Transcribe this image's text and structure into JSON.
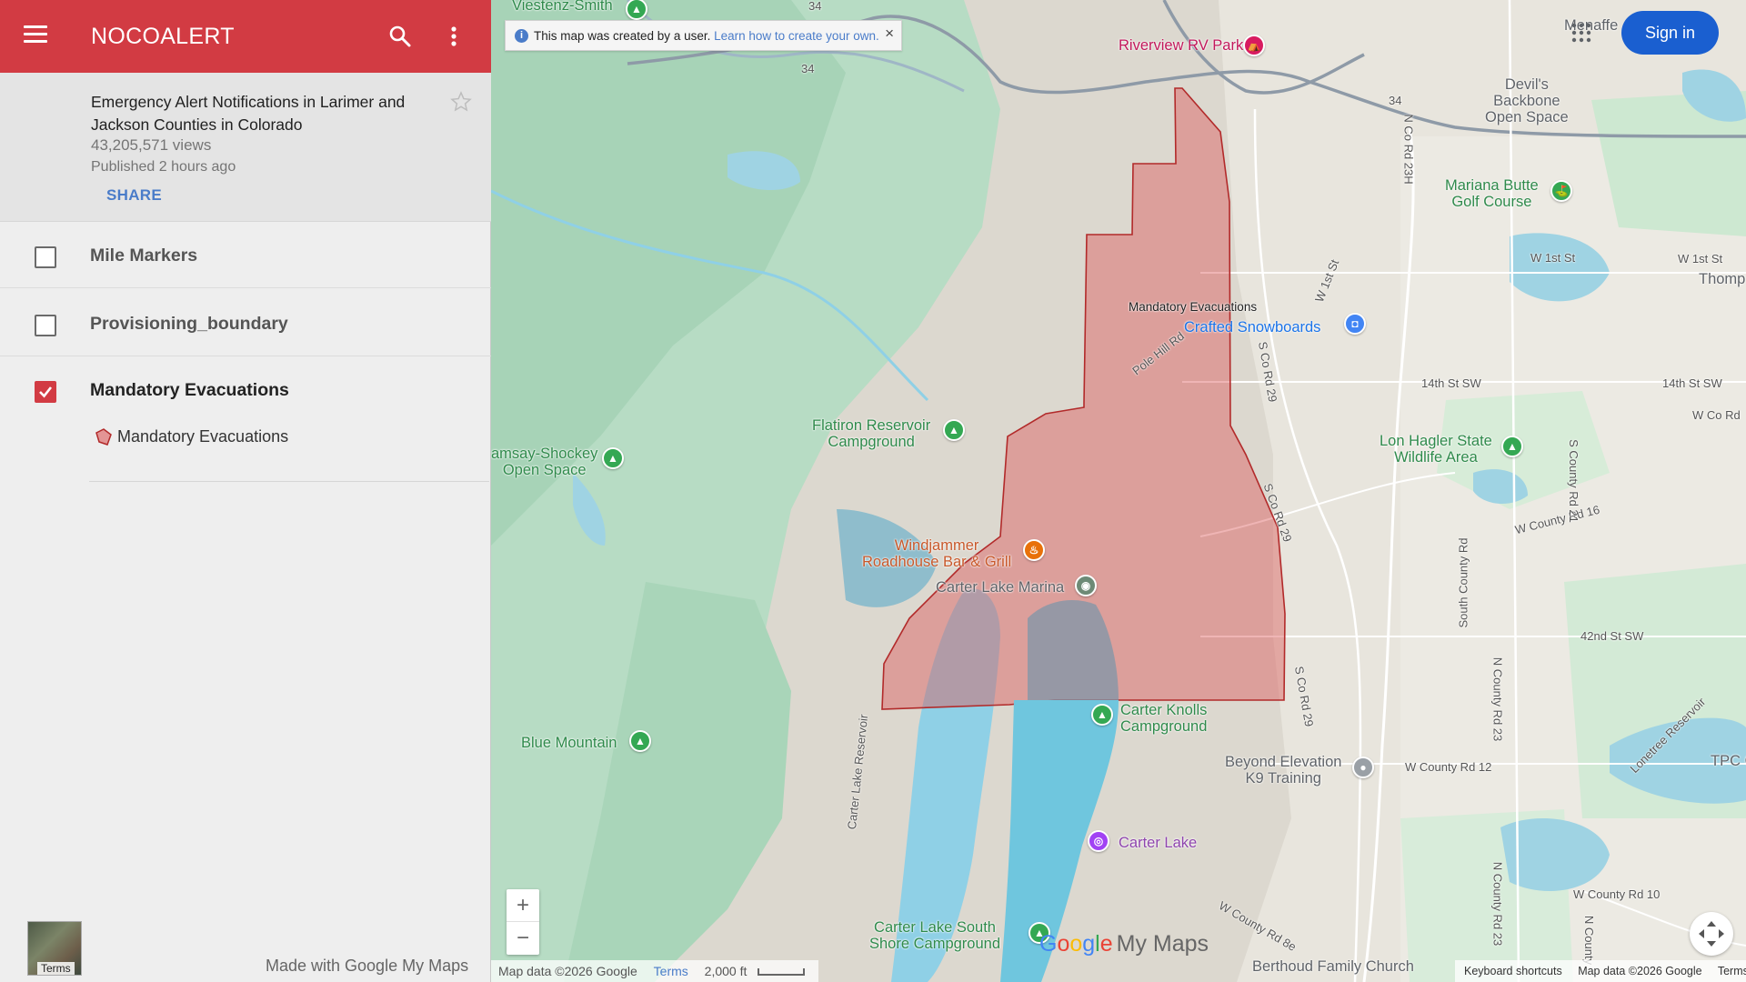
{
  "app": {
    "title": "NOCOALERT"
  },
  "map_info": {
    "description": "Emergency Alert Notifications in Larimer and Jackson Counties in Colorado",
    "views": "43,205,571 views",
    "published": "Published 2 hours ago",
    "share_label": "SHARE"
  },
  "layers": [
    {
      "name": "Mile Markers",
      "checked": false
    },
    {
      "name": "Provisioning_boundary",
      "checked": false
    },
    {
      "name": "Mandatory Evacuations",
      "checked": true,
      "items": [
        "Mandatory Evacuations"
      ]
    }
  ],
  "sidebar_footer": {
    "made_with": "Made with Google My Maps",
    "thumb_terms": "Terms"
  },
  "notice": {
    "text": "This map was created by a user.",
    "link": "Learn how to create your own.",
    "close": "×"
  },
  "header": {
    "sign_in": "Sign in"
  },
  "zoom": {
    "in": "+",
    "out": "−"
  },
  "logo": {
    "google": [
      "G",
      "o",
      "o",
      "g",
      "l",
      "e"
    ],
    "suffix": "My Maps"
  },
  "attribution": {
    "map_data": "Map data ©2026 Google",
    "terms": "Terms",
    "scale": "2,000 ft",
    "keyboard_shortcuts": "Keyboard shortcuts",
    "map_data_right": "Map data ©2026 Google",
    "terms_right": "Terms"
  },
  "map_labels": {
    "viestenz_smith": "Viestenz-Smith",
    "riverview": "Riverview RV Park",
    "devils_backbone_1": "Devil's",
    "devils_backbone_2": "Backbone",
    "devils_backbone_3": "Open Space",
    "mariana_butte_1": "Mariana Butte",
    "mariana_butte_2": "Golf Course",
    "mandatory_evac": "Mandatory Evacuations",
    "crafted": "Crafted Snowboards",
    "flatiron_1": "Flatiron Reservoir",
    "flatiron_2": "Campground",
    "ramsay_1": "amsay-Shockey",
    "ramsay_2": "Open Space",
    "lon_hagler_1": "Lon Hagler State",
    "lon_hagler_2": "Wildlife Area",
    "windjammer_1": "Windjammer",
    "windjammer_2": "Roadhouse Bar & Grill",
    "carter_marina": "Carter Lake Marina",
    "carter_knolls_1": "Carter Knolls",
    "carter_knolls_2": "Campground",
    "blue_mountain": "Blue Mountain",
    "beyond_elevation_1": "Beyond Elevation",
    "beyond_elevation_2": "K9 Training",
    "carter_lake": "Carter Lake",
    "carter_south_1": "Carter Lake South",
    "carter_south_2": "Shore Campground",
    "berthoud": "Berthoud Family Church",
    "tpc": "TPC C",
    "thomp": "Thomp",
    "menaffe": "Menaffe",
    "w1st_a": "W 1st St",
    "w1st_b": "W 1st St",
    "w14th_a": "14th St SW",
    "w14th_b": "14th St SW",
    "wcord": "W Co Rd",
    "w42nd": "42nd St SW",
    "wcr16": "W County Rd 16",
    "wcr12": "W County Rd 12",
    "wcr10": "W County Rd 10",
    "lonetree": "Lonetree Reservoir",
    "ncord23h": "N Co Rd 23H",
    "w1st_diag": "W 1st St",
    "pole_hill": "Pole Hill Rd",
    "sco29_a": "S Co Rd 29",
    "sco29_b": "S Co Rd 29",
    "sco29_c": "S Co Rd 29",
    "scr21": "S County Rd 21",
    "south_cr": "South County Rd",
    "ncr23_a": "N County Rd 23",
    "ncr23_b": "N County Rd 23",
    "ncounty_rd": "N County",
    "wcr8e": "W County Rd 8e",
    "carter_res_rd": "Carter Lake Reservoir",
    "hwy34_a": "34",
    "hwy34_b": "34",
    "hwy34_c": "34"
  },
  "colors": {
    "brand_red": "#d23b43",
    "link_blue": "#4a7cc9",
    "evac_fill": "rgba(220,90,90,0.45)",
    "evac_stroke": "#b22a2a"
  }
}
